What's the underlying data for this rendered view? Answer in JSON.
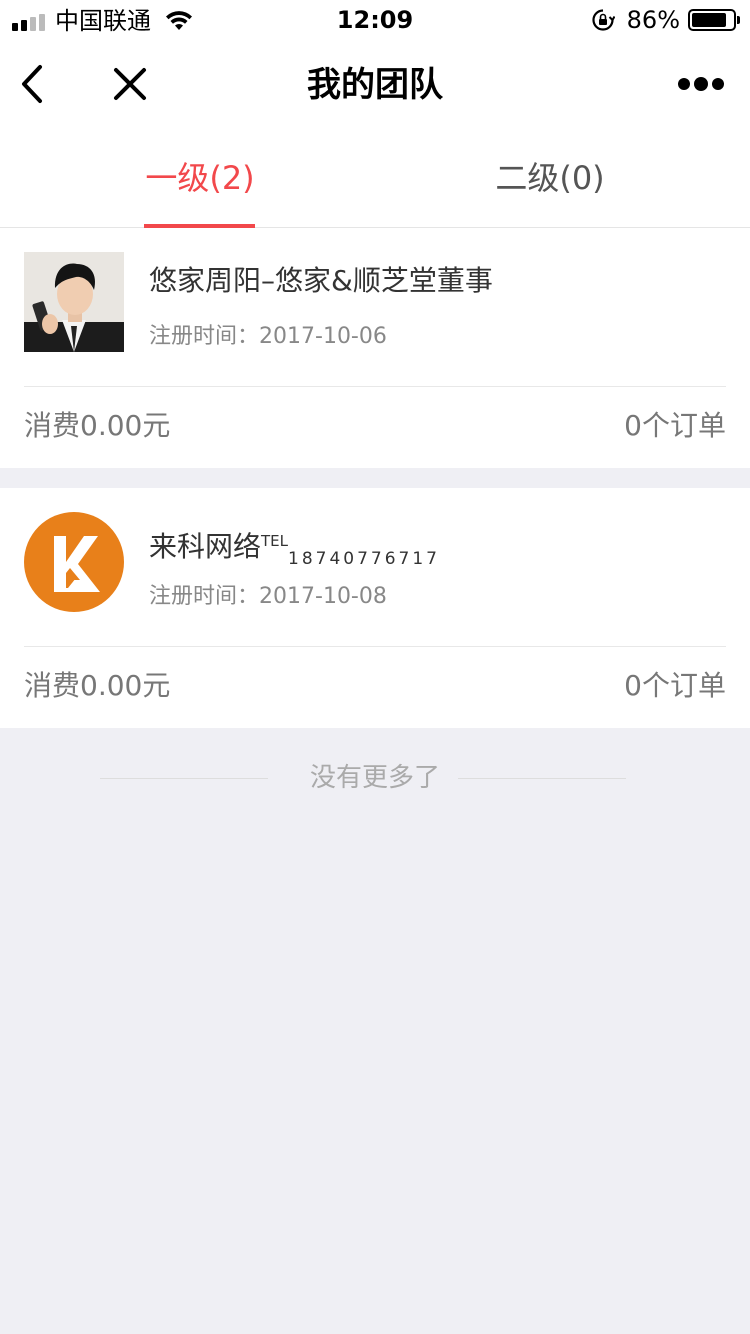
{
  "status_bar": {
    "carrier": "中国联通",
    "time": "12:09",
    "battery_percent": "86%",
    "battery_level": 0.86
  },
  "nav": {
    "title": "我的团队",
    "back_icon": "chevron-left-icon",
    "close_icon": "close-icon",
    "more_icon": "more-dots-icon"
  },
  "tabs": [
    {
      "label": "一级(2)",
      "active": true
    },
    {
      "label": "二级(0)",
      "active": false
    }
  ],
  "members": [
    {
      "name": "悠家周阳–悠家&顺芝堂董事",
      "date_label": "注册时间：",
      "date": "2017-10-06",
      "spend": "消费0.00元",
      "orders": "0个订单"
    },
    {
      "name": "来科网络",
      "tel_label": "TEL",
      "tel": "18740776717",
      "date_label": "注册时间：",
      "date": "2017-10-08",
      "spend": "消费0.00元",
      "orders": "0个订单"
    }
  ],
  "footer": {
    "no_more": "没有更多了"
  },
  "colors": {
    "accent": "#f2484b",
    "logo_orange": "#e8801a",
    "background": "#efeff4"
  }
}
